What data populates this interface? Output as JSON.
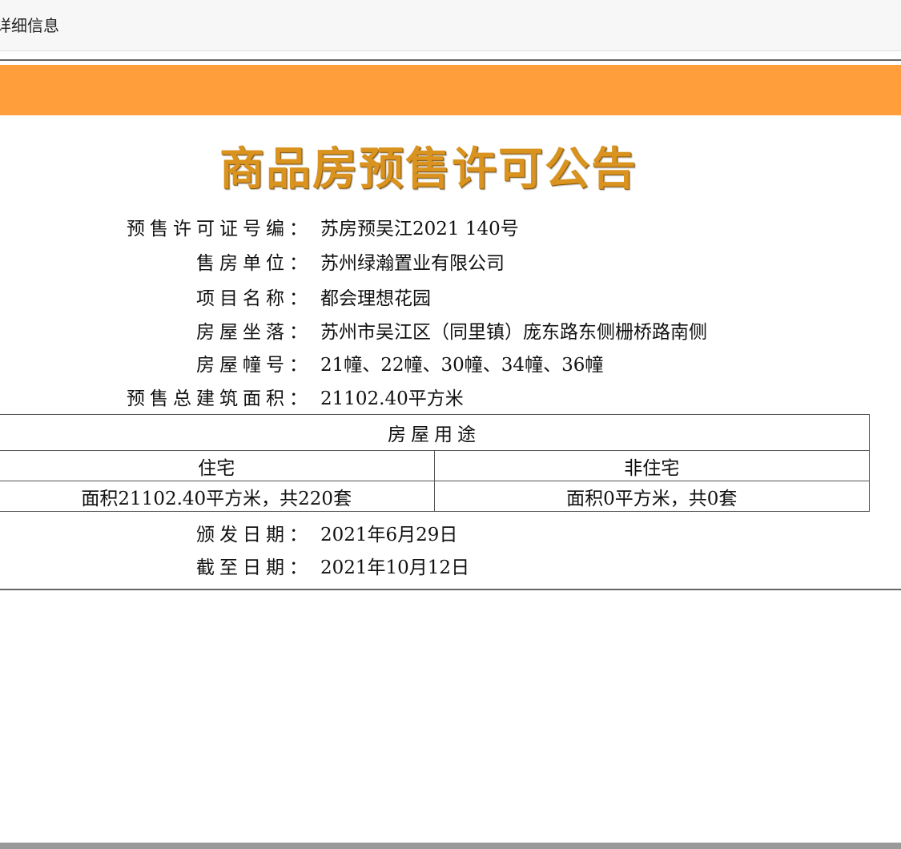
{
  "topbar": {
    "title": "详细信息"
  },
  "notice": {
    "title": "商品房预售许可公告",
    "fields": [
      {
        "label": "预售许可证号编：",
        "value": "苏房预吴江2021 140号"
      },
      {
        "label": "售房单位：",
        "value": "苏州绿瀚置业有限公司"
      },
      {
        "label": "项目名称：",
        "value": "都会理想花园"
      },
      {
        "label": "房屋坐落：",
        "value": "苏州市吴江区（同里镇）庞东路东侧栅桥路南侧"
      },
      {
        "label": "房屋幢号：",
        "value": "21幢、22幢、30幢、34幢、36幢"
      },
      {
        "label": "预售总建筑面积：",
        "value": "21102.40平方米"
      }
    ],
    "usage_table": {
      "header": "房屋用途",
      "columns": [
        "住宅",
        "非住宅"
      ],
      "values": [
        "面积21102.40平方米，共220套",
        "面积0平方米，共0套"
      ]
    },
    "dates": [
      {
        "label": "颁发日期：",
        "value": "2021年6月29日"
      },
      {
        "label": "截至日期：",
        "value": "2021年10月12日"
      }
    ]
  },
  "colors": {
    "banner": "#ff9e3a",
    "title": "#d9931e"
  }
}
